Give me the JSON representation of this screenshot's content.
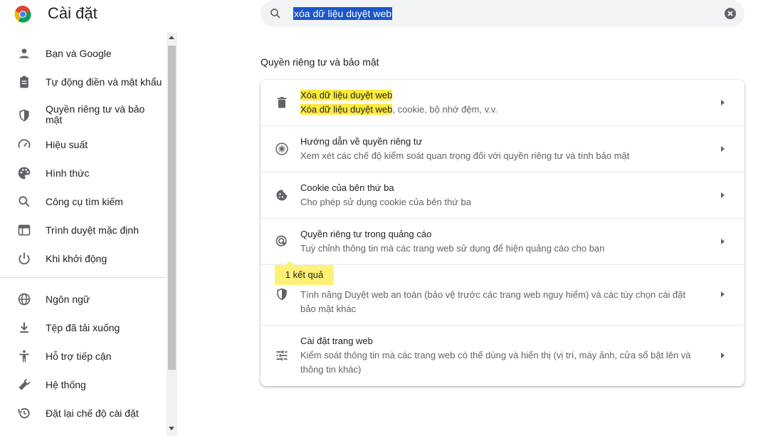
{
  "header": {
    "title": "Cài đặt",
    "search_value": "xóa dữ liệu duyệt web"
  },
  "sidebar": {
    "items": [
      {
        "label": "Bạn và Google",
        "icon": "person-icon"
      },
      {
        "label": "Tự động điền và mật khẩu",
        "icon": "clipboard-icon"
      },
      {
        "label": "Quyền riêng tư và bảo mật",
        "icon": "shield-icon"
      },
      {
        "label": "Hiệu suất",
        "icon": "speedometer-icon"
      },
      {
        "label": "Hình thức",
        "icon": "palette-icon"
      },
      {
        "label": "Công cụ tìm kiếm",
        "icon": "search-icon"
      },
      {
        "label": "Trình duyệt mặc định",
        "icon": "browser-window-icon"
      },
      {
        "label": "Khi khởi động",
        "icon": "power-icon"
      },
      {
        "label": "Ngôn ngữ",
        "icon": "globe-icon"
      },
      {
        "label": "Tệp đã tải xuống",
        "icon": "download-icon"
      },
      {
        "label": "Hỗ trợ tiếp cận",
        "icon": "accessibility-icon"
      },
      {
        "label": "Hệ thống",
        "icon": "wrench-icon"
      },
      {
        "label": "Đặt lại chế độ cài đặt",
        "icon": "restore-icon"
      }
    ]
  },
  "main": {
    "section_title": "Quyền riêng tư và bảo mật",
    "rows": [
      {
        "title": "Xóa dữ liệu duyệt web",
        "desc_highlight": "Xóa dữ liệu duyệt web",
        "desc_rest": ", cookie, bộ nhớ đệm, v.v.",
        "icon": "trash-icon"
      },
      {
        "title": "Hướng dẫn về quyền riêng tư",
        "desc": "Xem xét các chế độ kiểm soát quan trọng đối với quyền riêng tư và tính bảo mật",
        "icon": "privacy-guide-icon"
      },
      {
        "title": "Cookie của bên thứ ba",
        "desc": "Cho phép sử dụng cookie của bên thứ ba",
        "icon": "cookie-icon"
      },
      {
        "title": "Quyền riêng tư trong quảng cáo",
        "desc": "Tuỳ chỉnh thông tin mà các trang web sử dụng để hiện quảng cáo cho bạn",
        "icon": "ad-privacy-icon"
      },
      {
        "title": "",
        "desc": "Tính năng Duyệt web an toàn (bảo vệ trước các trang web nguy hiểm) và các tùy chọn cài đặt bảo mật khác",
        "icon": "shield-icon"
      },
      {
        "title": "Cài đặt trang web",
        "desc": "Kiểm soát thông tin mà các trang web có thể dùng và hiển thị (vị trí, máy ảnh, cửa sổ bật lên và thông tin khác)",
        "icon": "sliders-icon"
      }
    ],
    "result_bubble": "1 kết quả"
  },
  "colors": {
    "highlight": "#ffeb3b",
    "bubble": "#fff176",
    "selection": "#1a55c9"
  }
}
